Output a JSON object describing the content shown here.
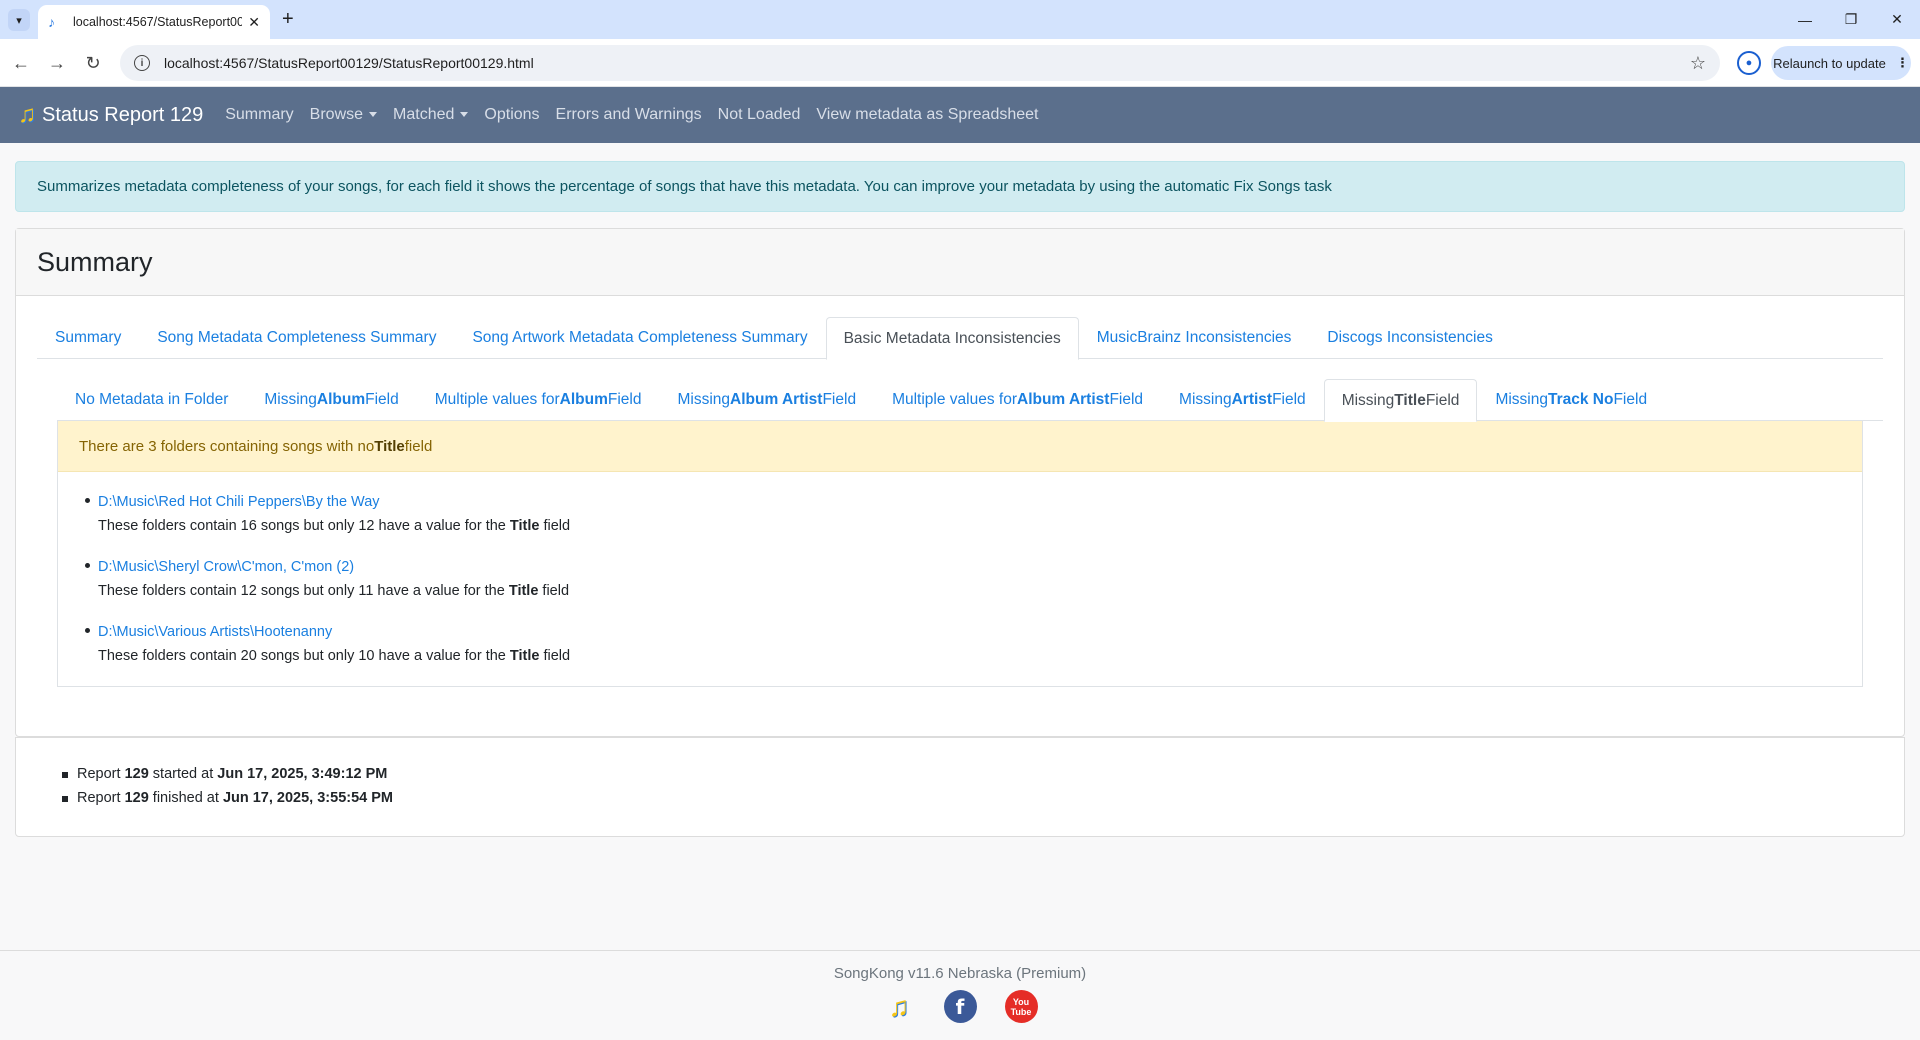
{
  "browser": {
    "tab_title": "localhost:4567/StatusReport001",
    "url": "localhost:4567/StatusReport00129/StatusReport00129.html",
    "relaunch_label": "Relaunch to update"
  },
  "navbar": {
    "brand": "Status Report 129",
    "links": [
      "Summary",
      "Browse",
      "Matched",
      "Options",
      "Errors and Warnings",
      "Not Loaded",
      "View metadata as Spreadsheet"
    ]
  },
  "info_text": "Summarizes metadata completeness of your songs, for each field it shows the percentage of songs that have this metadata. You can improve your metadata by using the automatic Fix Songs task",
  "card_title": "Summary",
  "main_tabs": [
    "Summary",
    "Song Metadata Completeness Summary",
    "Song Artwork Metadata Completeness Summary",
    "Basic Metadata Inconsistencies",
    "MusicBrainz Inconsistencies",
    "Discogs Inconsistencies"
  ],
  "sub_tabs": [
    {
      "pre": "No Metadata in Folder",
      "bold": "",
      "post": ""
    },
    {
      "pre": "Missing ",
      "bold": "Album",
      "post": " Field"
    },
    {
      "pre": "Multiple values for ",
      "bold": "Album",
      "post": " Field"
    },
    {
      "pre": "Missing ",
      "bold": "Album Artist",
      "post": " Field"
    },
    {
      "pre": "Multiple values for ",
      "bold": "Album Artist",
      "post": " Field"
    },
    {
      "pre": "Missing ",
      "bold": "Artist",
      "post": " Field"
    },
    {
      "pre": "Missing ",
      "bold": "Title",
      "post": " Field"
    },
    {
      "pre": "Missing ",
      "bold": "Track No",
      "post": " Field"
    }
  ],
  "warning": {
    "pre": "There are 3 folders containing songs with no ",
    "bold": "Title",
    "post": " field"
  },
  "folders": [
    {
      "path": "D:\\Music\\Red Hot Chili Peppers\\By the Way",
      "desc_pre": "These folders contain 16 songs but only 12 have a value for the ",
      "field": "Title",
      "desc_post": " field"
    },
    {
      "path": "D:\\Music\\Sheryl Crow\\C'mon, C'mon (2)",
      "desc_pre": "These folders contain 12 songs but only 11 have a value for the ",
      "field": "Title",
      "desc_post": " field"
    },
    {
      "path": "D:\\Music\\Various Artists\\Hootenanny",
      "desc_pre": "These folders contain 20 songs but only 10 have a value for the ",
      "field": "Title",
      "desc_post": " field"
    }
  ],
  "times": [
    {
      "pre": "Report ",
      "num": "129",
      "mid": " started at ",
      "time": "Jun 17, 2025, 3:49:12 PM"
    },
    {
      "pre": "Report ",
      "num": "129",
      "mid": " finished at ",
      "time": "Jun 17, 2025, 3:55:54 PM"
    }
  ],
  "footer": {
    "version": "SongKong v11.6 Nebraska (Premium)",
    "yt_label": "You Tube"
  }
}
